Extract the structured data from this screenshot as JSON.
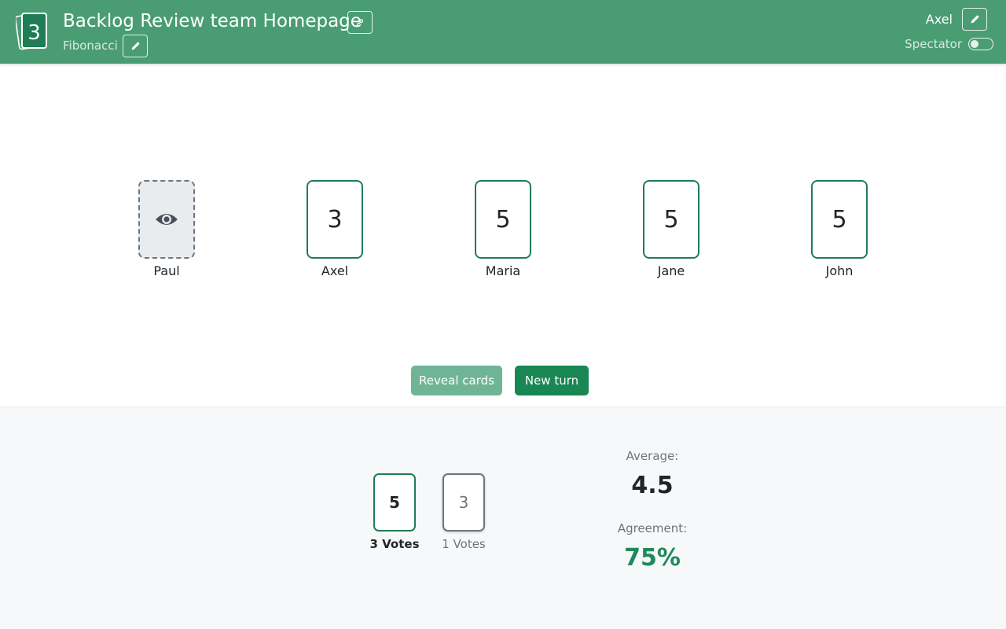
{
  "header": {
    "title": "Backlog Review team Homepage",
    "logo_value": "3",
    "deck_name": "Fibonacci",
    "user_name": "Axel",
    "spectator_label": "Spectator",
    "spectator_on": false
  },
  "colors": {
    "header_bg": "#4a9d73",
    "accent": "#1f7d55",
    "primary_button": "#198754",
    "disabled_button": "#6fb595"
  },
  "icons": {
    "link": "link-icon",
    "edit": "pencil-icon",
    "spectator": "eye-icon"
  },
  "table": {
    "players": [
      {
        "name": "Paul",
        "card": "",
        "spectator": true
      },
      {
        "name": "Axel",
        "card": "3",
        "spectator": false
      },
      {
        "name": "Maria",
        "card": "5",
        "spectator": false
      },
      {
        "name": "Jane",
        "card": "5",
        "spectator": false
      },
      {
        "name": "John",
        "card": "5",
        "spectator": false
      }
    ]
  },
  "actions": {
    "reveal_label": "Reveal cards",
    "new_turn_label": "New turn"
  },
  "results": {
    "votes": [
      {
        "card": "5",
        "count_label": "3 Votes"
      },
      {
        "card": "3",
        "count_label": "1 Votes"
      }
    ],
    "average_label": "Average:",
    "average_value": "4.5",
    "agreement_label": "Agreement:",
    "agreement_value": "75%"
  }
}
